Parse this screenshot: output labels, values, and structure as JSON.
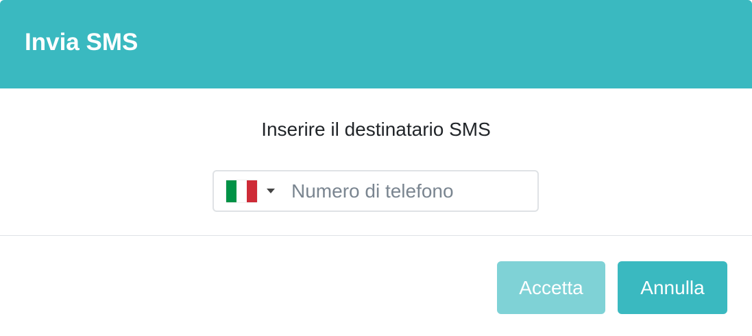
{
  "dialog": {
    "title": "Invia SMS",
    "prompt": "Inserire il destinatario SMS"
  },
  "phone": {
    "country_flag": "it-flag-icon",
    "flag_colors": [
      "#009246",
      "#ffffff",
      "#ce2b37"
    ],
    "placeholder": "Numero di telefono",
    "value": ""
  },
  "footer": {
    "accept_label": "Accetta",
    "cancel_label": "Annulla"
  },
  "colors": {
    "accent": "#3ab9c0",
    "accent_disabled": "#7fd2d6"
  }
}
